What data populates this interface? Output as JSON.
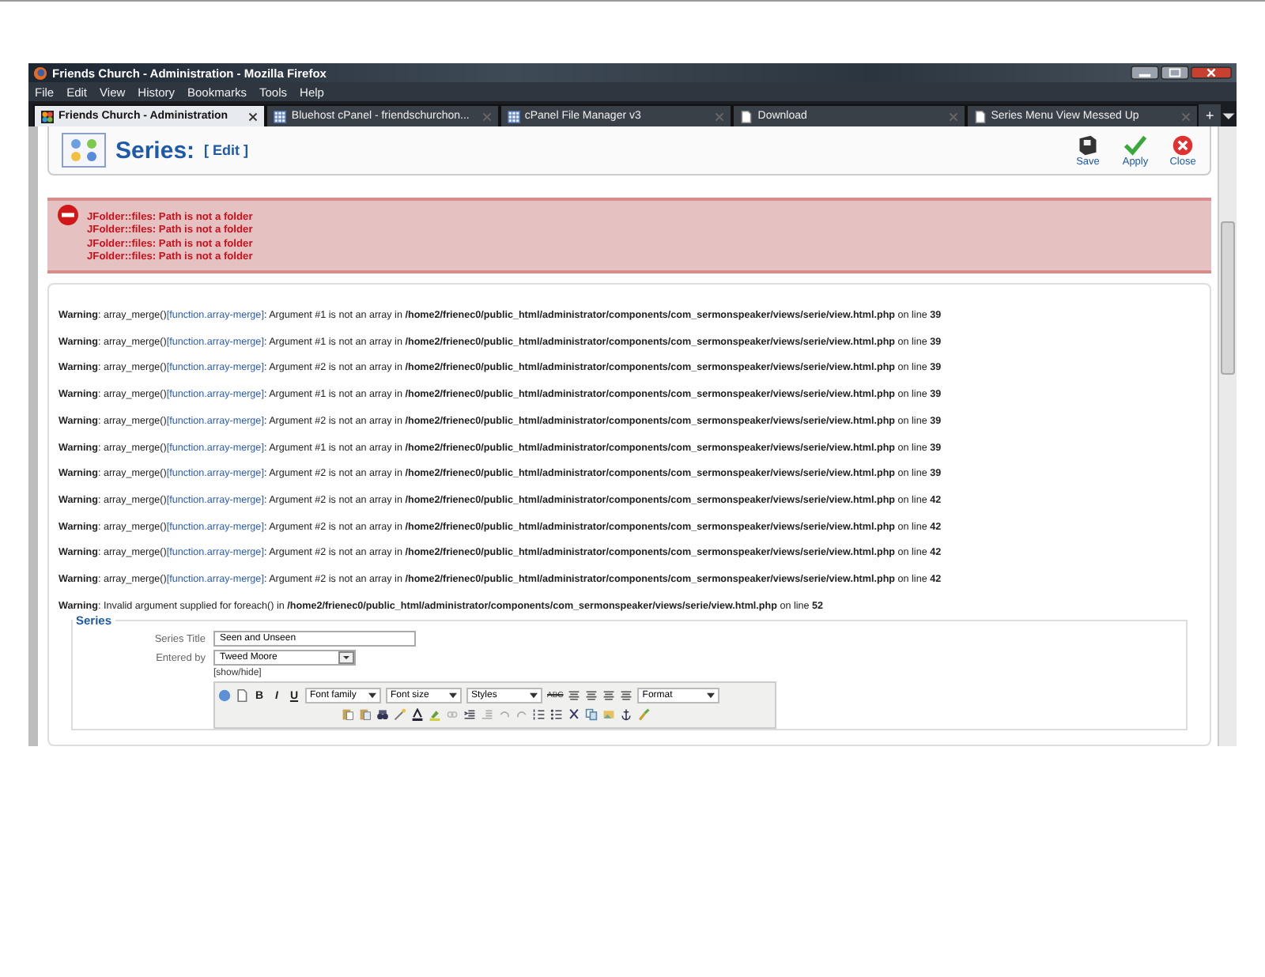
{
  "window": {
    "title": "Friends Church - Administration - Mozilla Firefox"
  },
  "menu": [
    "File",
    "Edit",
    "View",
    "History",
    "Bookmarks",
    "Tools",
    "Help"
  ],
  "tabs": [
    {
      "label": "Friends Church - Administration",
      "selected": true,
      "kind": "site"
    },
    {
      "label": "Bluehost cPanel - friendschurchon...",
      "selected": false,
      "kind": "grid"
    },
    {
      "label": "cPanel File Manager v3",
      "selected": false,
      "kind": "grid"
    },
    {
      "label": "Download",
      "selected": false,
      "kind": "page"
    },
    {
      "label": "Series Menu View Messed Up",
      "selected": false,
      "kind": "page"
    }
  ],
  "new_tab": "+",
  "header": {
    "title": "Series:",
    "subtitle": "[ Edit ]",
    "buttons": [
      {
        "label": "Save",
        "kind": "save"
      },
      {
        "label": "Apply",
        "kind": "apply"
      },
      {
        "label": "Close",
        "kind": "close"
      }
    ]
  },
  "errors": [
    "JFolder::files: Path is not a folder",
    "JFolder::files: Path is not a folder",
    "JFolder::files: Path is not a folder",
    "JFolder::files: Path is not a folder"
  ],
  "warnings": [
    {
      "head": "**Warning**: array_merge()",
      "link": "[function.array-merge]",
      "tail": ": Argument #1 is not an array in **/home2/frienec0/public_html/administrator/components/com_sermonspeaker/views/serie/view.html.php** on line **39**"
    },
    {
      "head": "**Warning**: array_merge()",
      "link": "[function.array-merge]",
      "tail": ": Argument #1 is not an array in **/home2/frienec0/public_html/administrator/components/com_sermonspeaker/views/serie/view.html.php** on line **39**"
    },
    {
      "head": "**Warning**: array_merge()",
      "link": "[function.array-merge]",
      "tail": ": Argument #2 is not an array in **/home2/frienec0/public_html/administrator/components/com_sermonspeaker/views/serie/view.html.php** on line **39**"
    },
    {
      "head": "**Warning**: array_merge()",
      "link": "[function.array-merge]",
      "tail": ": Argument #1 is not an array in **/home2/frienec0/public_html/administrator/components/com_sermonspeaker/views/serie/view.html.php** on line **39**"
    },
    {
      "head": "**Warning**: array_merge()",
      "link": "[function.array-merge]",
      "tail": ": Argument #2 is not an array in **/home2/frienec0/public_html/administrator/components/com_sermonspeaker/views/serie/view.html.php** on line **39**"
    },
    {
      "head": "**Warning**: array_merge()",
      "link": "[function.array-merge]",
      "tail": ": Argument #1 is not an array in **/home2/frienec0/public_html/administrator/components/com_sermonspeaker/views/serie/view.html.php** on line **39**"
    },
    {
      "head": "**Warning**: array_merge()",
      "link": "[function.array-merge]",
      "tail": ": Argument #2 is not an array in **/home2/frienec0/public_html/administrator/components/com_sermonspeaker/views/serie/view.html.php** on line **39**"
    },
    {
      "head": "**Warning**: array_merge()",
      "link": "[function.array-merge]",
      "tail": ": Argument #2 is not an array in **/home2/frienec0/public_html/administrator/components/com_sermonspeaker/views/serie/view.html.php** on line **42**"
    },
    {
      "head": "**Warning**: array_merge()",
      "link": "[function.array-merge]",
      "tail": ": Argument #2 is not an array in **/home2/frienec0/public_html/administrator/components/com_sermonspeaker/views/serie/view.html.php** on line **42**"
    },
    {
      "head": "**Warning**: array_merge()",
      "link": "[function.array-merge]",
      "tail": ": Argument #2 is not an array in **/home2/frienec0/public_html/administrator/components/com_sermonspeaker/views/serie/view.html.php** on line **42**"
    },
    {
      "head": "**Warning**: array_merge()",
      "link": "[function.array-merge]",
      "tail": ": Argument #2 is not an array in **/home2/frienec0/public_html/administrator/components/com_sermonspeaker/views/serie/view.html.php** on line **42**"
    },
    {
      "head": "**Warning**: Invalid argument supplied for foreach() in **/home2/frienec0/public_html/administrator/components/com_sermonspeaker/views/serie/view.html.php** on line **52**"
    }
  ],
  "form": {
    "legend": "Series",
    "fields": [
      {
        "label": "Series Title",
        "kind": "text",
        "value": "Seen and Unseen"
      },
      {
        "label": "Entered by",
        "kind": "select",
        "value": "Tweed Moore"
      }
    ],
    "toggle": "[show/hide]",
    "editor": {
      "styles": [
        "B",
        "I",
        "U"
      ],
      "selects": [
        "Font family",
        "Font size",
        "Styles"
      ],
      "spell": "ABC",
      "format": "Format"
    }
  }
}
